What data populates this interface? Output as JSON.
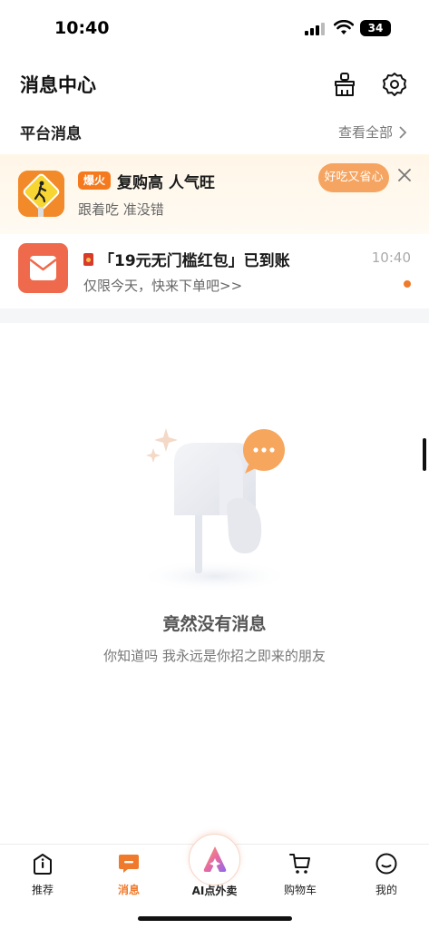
{
  "status_bar": {
    "time": "10:40",
    "battery": "34"
  },
  "header": {
    "title": "消息中心"
  },
  "platform_section": {
    "title": "平台消息",
    "view_all": "查看全部"
  },
  "promo": {
    "tag": "爆火",
    "title": "复购高 人气旺",
    "subtitle": "跟着吃 准没错",
    "bubble": "好吃又省心"
  },
  "red_packet_message": {
    "title": "「19元无门槛红包」已到账",
    "subtitle": "仅限今天，快来下单吧>>",
    "time": "10:40"
  },
  "empty_state": {
    "title": "竟然没有消息",
    "subtitle": "你知道吗 我永远是你招之即来的朋友"
  },
  "tabbar": {
    "items": [
      {
        "label": "推荐",
        "icon": "home-info-icon",
        "active": false
      },
      {
        "label": "消息",
        "icon": "message-icon",
        "active": true
      },
      {
        "label": "AI点外卖",
        "icon": "ai-logo-icon",
        "active": false
      },
      {
        "label": "购物车",
        "icon": "cart-icon",
        "active": false
      },
      {
        "label": "我的",
        "icon": "profile-icon",
        "active": false
      }
    ]
  },
  "colors": {
    "accent": "#f07a2c",
    "promo_bg": "#fff6e8",
    "red_packet": "#ef6a4c"
  }
}
